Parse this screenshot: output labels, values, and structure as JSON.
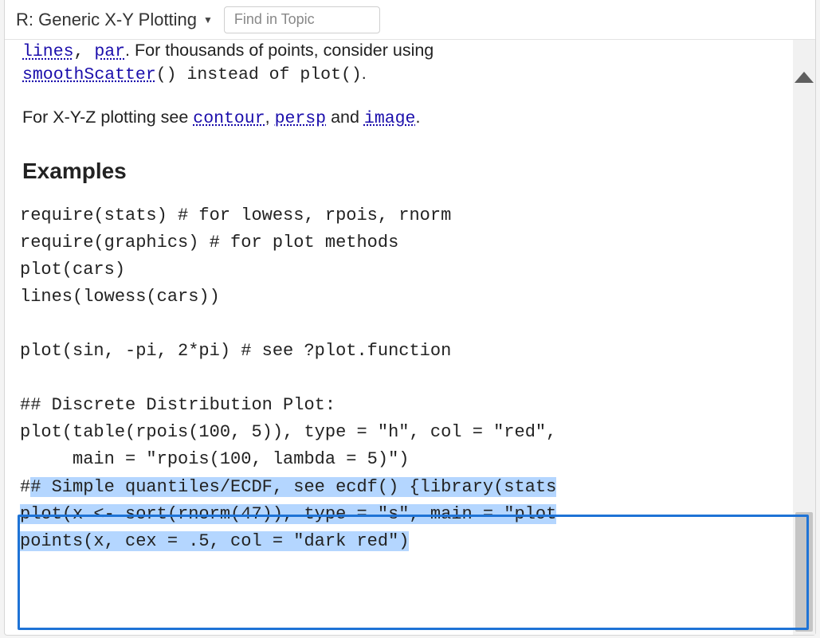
{
  "toolbar": {
    "title": "R: Generic X-Y Plotting",
    "find_placeholder": "Find in Topic"
  },
  "body": {
    "cutoff_links": {
      "lines": "lines",
      "par": "par"
    },
    "cutoff_rest": ". For thousands of points, consider using",
    "smoothScatter": "smoothScatter",
    "instead_of": "() instead of ",
    "plot_fn": "plot()",
    "period": ".",
    "xyz_pre": "For X-Y-Z plotting see ",
    "contour": "contour",
    "persp": "persp",
    "image": "image",
    "examples_heading": "Examples",
    "code_block1": "require(stats) # for lowess, rpois, rnorm\nrequire(graphics) # for plot methods\nplot(cars)\nlines(lowess(cars))\n\nplot(sin, -pi, 2*pi) # see ?plot.function\n\n## Discrete Distribution Plot:\nplot(table(rpois(100, 5)), type = \"h\", col = \"red\",\n     main = \"rpois(100, lambda = 5)\")",
    "sel_line1_a": "#",
    "sel_line1_b": "# Simple quantiles/ECDF, see ecdf() {library(stats",
    "sel_line2": "plot(x <- sort(rnorm(47)), type = \"s\", main = \"plot",
    "sel_line3": "points(x, cex = .5, col = \"dark red\")"
  }
}
